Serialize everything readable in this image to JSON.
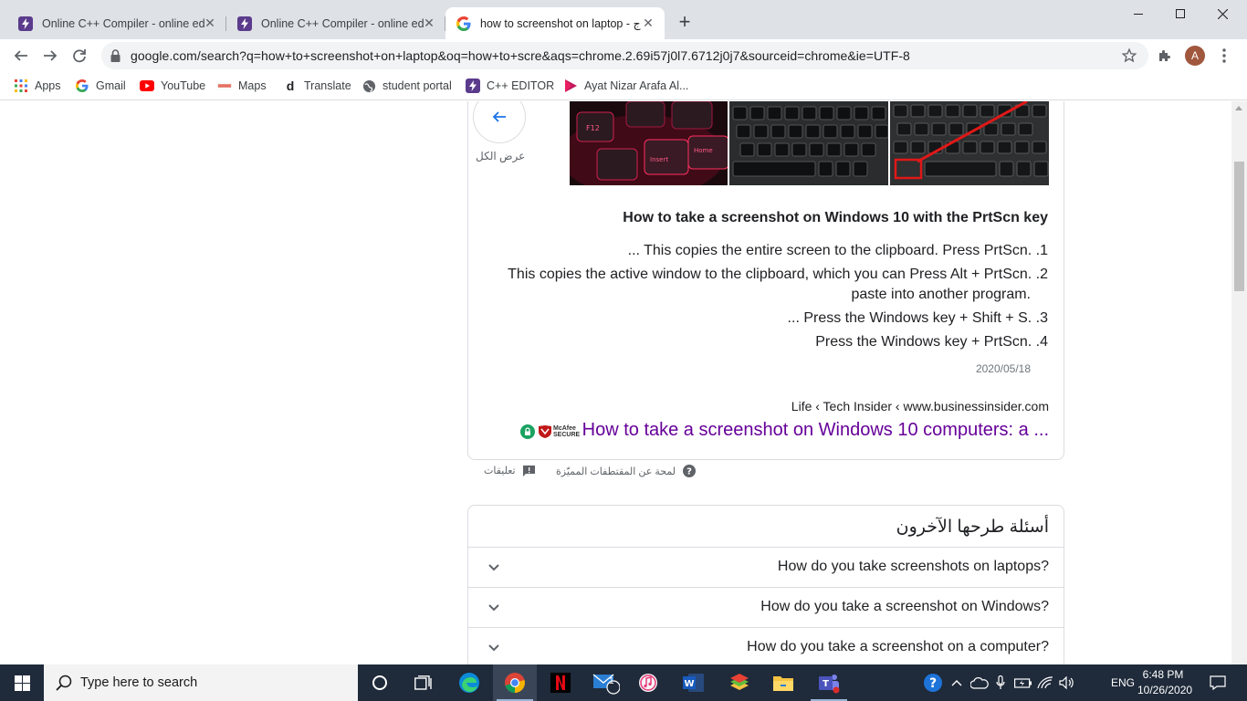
{
  "browser": {
    "tabs": [
      {
        "title": "Online C++ Compiler - online ed",
        "active": false
      },
      {
        "title": "Online C++ Compiler - online ed",
        "active": false
      },
      {
        "title": "how to screenshot on laptop - ج",
        "active": true
      }
    ],
    "url": "google.com/search?q=how+to+screenshot+on+laptop&oq=how+to+scre&aqs=chrome.2.69i57j0l7.6712j0j7&sourceid=chrome&ie=UTF-8",
    "profile_initial": "A",
    "bookmarks": [
      "Apps",
      "Gmail",
      "YouTube",
      "Maps",
      "Translate",
      "student portal",
      "C++ EDITOR",
      "Ayat Nizar Arafa Al..."
    ]
  },
  "featured": {
    "show_all": "عرض الكل",
    "title": "How to take a screenshot on Windows 10 with the PrtScn key",
    "steps": [
      {
        "text": "... This copies the entire screen to the clipboard. Press PrtScn. .1"
      },
      {
        "text": "This copies the active window to the clipboard, which you can Press Alt + PrtScn. .2",
        "text2": "paste into another program."
      },
      {
        "text": "... Press the Windows key + Shift + S. .3"
      },
      {
        "text": "Press the Windows key + PrtScn. .4"
      }
    ],
    "date": "2020/05/18",
    "cite": "Life ‹ Tech Insider ‹ www.businessinsider.com",
    "link": "How to take a screenshot on Windows 10 computers: a ...",
    "badge": "McAfee SECURE",
    "feedback_about": "لمحة عن المقتطفات المميّزة",
    "feedback_comments": "تعليقات"
  },
  "paa": {
    "title": "أسئلة طرحها الآخرون",
    "questions": [
      "How do you take screenshots on laptops?",
      "How do you take a screenshot on Windows?",
      "How do you take a screenshot on a computer?"
    ]
  },
  "taskbar": {
    "search_placeholder": "Type here to search",
    "mail_badge": "1",
    "lang": "ENG",
    "time": "6:48 PM",
    "date": "10/26/2020"
  },
  "colors": {
    "link_visited": "#660099",
    "accent": "#1a73e8"
  }
}
